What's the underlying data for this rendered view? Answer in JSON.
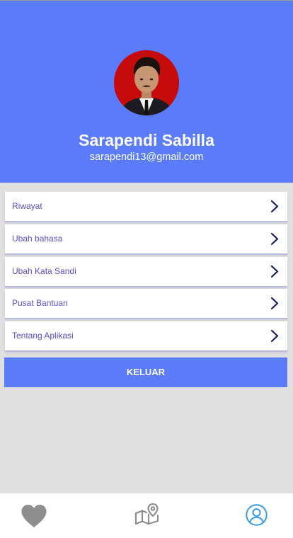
{
  "profile": {
    "name": "Sarapendi Sabilla",
    "email": "sarapendi13@gmail.com"
  },
  "menu": {
    "items": [
      {
        "label": "Riwayat"
      },
      {
        "label": "Ubah bahasa"
      },
      {
        "label": "Ubah Kata Sandi"
      },
      {
        "label": "Pusat Bantuan"
      },
      {
        "label": "Tentang Aplikasi"
      }
    ]
  },
  "logout": {
    "label": "KELUAR"
  },
  "bottom_nav": {
    "items": [
      {
        "icon": "heart-icon",
        "active": false
      },
      {
        "icon": "map-pin-icon",
        "active": false
      },
      {
        "icon": "profile-icon",
        "active": true
      }
    ]
  },
  "colors": {
    "primary": "#5b7cfa",
    "background": "#e0e0e0",
    "menu_text": "#5a4fd1",
    "chevron": "#1a1a66",
    "nav_inactive": "#8e8e8e",
    "nav_active": "#3a9ae6"
  }
}
